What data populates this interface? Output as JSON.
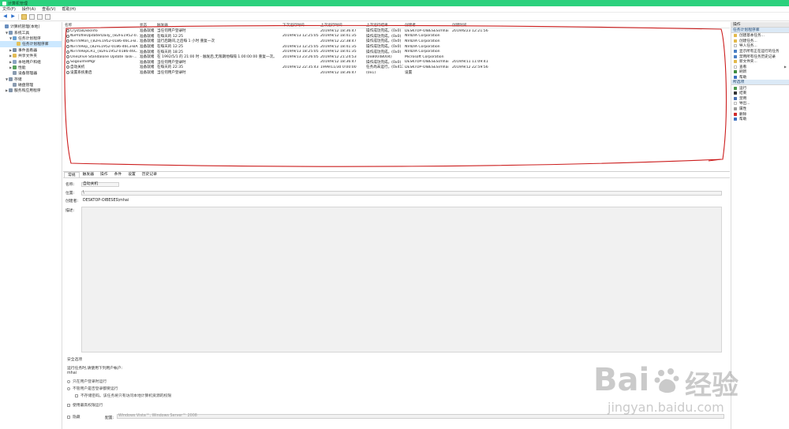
{
  "window": {
    "title": "计算机管理"
  },
  "menu": [
    "文件(F)",
    "操作(A)",
    "查看(V)",
    "帮助(H)"
  ],
  "tree": [
    {
      "label": "计算机管理(本地)",
      "level": 0,
      "arrow": "",
      "color": "#6a8fbf",
      "selected": false
    },
    {
      "label": "系统工具",
      "level": 1,
      "arrow": "▼",
      "color": "#7d97b6",
      "selected": false
    },
    {
      "label": "任务计划程序",
      "level": 2,
      "arrow": "▼",
      "color": "#6aa0d0",
      "selected": false
    },
    {
      "label": "任务计划程序库",
      "level": 3,
      "arrow": "",
      "color": "#e4c15c",
      "selected": true
    },
    {
      "label": "事件查看器",
      "level": 2,
      "arrow": "▶",
      "color": "#7a8fa8",
      "selected": false
    },
    {
      "label": "共享文件夹",
      "level": 2,
      "arrow": "▶",
      "color": "#e2bc55",
      "selected": false
    },
    {
      "label": "本地用户和组",
      "level": 2,
      "arrow": "▶",
      "color": "#8aa3c2",
      "selected": false
    },
    {
      "label": "性能",
      "level": 2,
      "arrow": "▶",
      "color": "#58a35e",
      "selected": false
    },
    {
      "label": "设备管理器",
      "level": 2,
      "arrow": "",
      "color": "#8a9bb0",
      "selected": false
    },
    {
      "label": "存储",
      "level": 1,
      "arrow": "▼",
      "color": "#8395ab",
      "selected": false
    },
    {
      "label": "磁盘管理",
      "level": 2,
      "arrow": "",
      "color": "#8a9bb0",
      "selected": false
    },
    {
      "label": "服务和应用程序",
      "level": 1,
      "arrow": "▶",
      "color": "#8395ab",
      "selected": false
    }
  ],
  "task_list": {
    "columns": [
      "名称",
      "状态",
      "触发器",
      "下次运行时间",
      "上次运行时间",
      "上次运行结果",
      "创建者",
      "创建时间"
    ],
    "rows": [
      [
        "CrystalDiskInfo",
        "准备就绪",
        "当任何用户登录时",
        "",
        "2019/9/12 18:36:47",
        "操作成功完成。(0x0)",
        "DESKTOP-OIBESES\\mhai",
        "2019/6/23 12:21:56"
      ],
      [
        "NvProfileUpdaterDaily_{B2FE1952-0...",
        "准备就绪",
        "在每天的 12:25",
        "2019/9/13 12:25:05",
        "2019/9/12 18:41:35",
        "操作成功完成。(0x0)",
        "NVIDIA Corporation",
        ""
      ],
      [
        "NvTmMon_{B2FE1952-0186-46C3-B...",
        "准备就绪",
        "运行后期间,之后每 1 小时 重复一次",
        "",
        "2019/9/12 22:38:47",
        "操作成功完成。(0x0)",
        "NVIDIA Corporation",
        ""
      ],
      [
        "NvTmRep_{B2FE1952-0186-46C3-BA...",
        "准备就绪",
        "在每天的 12:25",
        "2019/9/13 12:25:05",
        "2019/9/12 18:41:35",
        "操作成功完成。(0x0)",
        "NVIDIA Corporation",
        ""
      ],
      [
        "NvTmRepCR1_{B2FE1952-0186-46C...",
        "准备就绪",
        "在每天的 18:25",
        "2019/9/13 18:25:05",
        "2019/9/12 18:41:35",
        "操作成功完成。(0x0)",
        "NVIDIA Corporation",
        ""
      ],
      [
        "OneDrive Standalone Update Task-...",
        "准备就绪",
        "在 1992/5/1 的 21:00 时 - 触发后,无限期地每隔 1.00:00:00 重复一次。",
        "2019/9/13 23:26:05",
        "2019/9/12 21:24:53",
        "(0x80048004)",
        "Microsoft Corporation",
        ""
      ],
      [
        "SogouImeMgr",
        "准备就绪",
        "当任何用户登录时",
        "",
        "2019/9/12 18:36:47",
        "操作成功完成。(0x0)",
        "DESKTOP-OIBESES\\mhai",
        "2019/9/11 11:09:41"
      ],
      [
        "自动关机",
        "准备就绪",
        "在每天的 22:35",
        "2019/9/12 22:35:43",
        "1999/11/30 0:00:00",
        "任务尚未运行。(0x41303)",
        "DESKTOP-OIBESES\\mhai",
        "2019/9/12 22:59:56"
      ],
      [
        "设置系统重启",
        "准备就绪",
        "当任何用户登录时",
        "",
        "2019/9/12 18:36:47",
        "(0x1)",
        "设置",
        ""
      ]
    ]
  },
  "detail": {
    "tabs": [
      "常规",
      "触发器",
      "操作",
      "条件",
      "设置",
      "历史记录"
    ],
    "name_label": "名称:",
    "name_value": "自动关机",
    "location_label": "位置:",
    "location_value": "\\",
    "author_label": "创建者:",
    "author_value": "DESKTOP-OIBESES\\mhai",
    "desc_label": "描述:",
    "security_title": "安全选项",
    "security_prompt": "运行任务时,请使用下列用户帐户:",
    "security_user": "mhai",
    "opt_logged_on": "只在用户登录时运行",
    "opt_any_logon": "不管用户是否登录都要运行",
    "opt_no_password": "不存储密码。该任务将只有访问本地计算机资源的权限",
    "opt_highest": "使用最高权限运行",
    "hidden_label": "隐藏",
    "config_label": "配置:",
    "config_value": "Windows Vista™, Windows Server™ 2008"
  },
  "actions": {
    "header": "操作",
    "section1": "任务计划程序库",
    "items1": [
      {
        "label": "创建基本任务...",
        "color": "#e3b94a",
        "sub": false
      },
      {
        "label": "创建任务...",
        "color": "#e3b94a",
        "sub": false
      },
      {
        "label": "导入任务...",
        "color": "#f0f0f0",
        "sub": false
      },
      {
        "label": "显示所有正在运行的任务",
        "color": "#4a7fc4",
        "sub": false
      },
      {
        "label": "禁用所有任务历史记录",
        "color": "#4a7fc4",
        "sub": false
      },
      {
        "label": "新文件夹...",
        "color": "#e3b94a",
        "sub": false
      },
      {
        "label": "查看",
        "color": "#ffffff",
        "sub": true
      },
      {
        "label": "刷新",
        "color": "#3f8d3f",
        "sub": false
      },
      {
        "label": "帮助",
        "color": "#3c6fc0",
        "sub": false
      }
    ],
    "section2": "所选项",
    "items2": [
      {
        "label": "运行",
        "color": "#4e9a4e",
        "sub": false
      },
      {
        "label": "结束",
        "color": "#333333",
        "sub": false
      },
      {
        "label": "禁用",
        "color": "#4a70b0",
        "sub": false
      },
      {
        "label": "导出...",
        "color": "#ffffff",
        "sub": false
      },
      {
        "label": "属性",
        "color": "#9a9a9a",
        "sub": false
      },
      {
        "label": "删除",
        "color": "#d22a2a",
        "sub": false
      },
      {
        "label": "帮助",
        "color": "#3c6fc0",
        "sub": false
      }
    ]
  },
  "watermark": {
    "brand_left": "Bai",
    "brand_right": "经验",
    "url": "jingyan.baidu.com"
  }
}
